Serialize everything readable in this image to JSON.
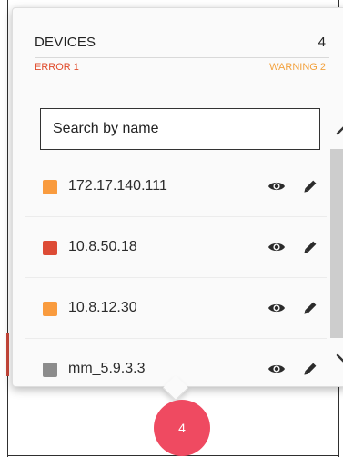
{
  "header": {
    "title": "DEVICES",
    "count": "4",
    "error_label": "ERROR 1",
    "warning_label": "WARNING 2"
  },
  "search": {
    "placeholder": "Search by name",
    "value": ""
  },
  "devices": [
    {
      "name": "172.17.140.111",
      "status": "warning",
      "status_color": "#F99B3E",
      "view_icon": "eye-icon",
      "edit_icon": "pencil-icon"
    },
    {
      "name": "10.8.50.18",
      "status": "error",
      "status_color": "#DD4B35",
      "view_icon": "eye-icon",
      "edit_icon": "pencil-icon"
    },
    {
      "name": "10.8.12.30",
      "status": "warning",
      "status_color": "#F99B3E",
      "view_icon": "eye-icon",
      "edit_icon": "pencil-icon"
    },
    {
      "name": "mm_5.9.3.3",
      "status": "unknown",
      "status_color": "#8C8C8C",
      "view_icon": "eye-icon",
      "edit_icon": "pencil-icon"
    }
  ],
  "scrollbar": {
    "up_icon": "chevron-up-icon",
    "down_icon": "chevron-down-icon"
  },
  "badge": {
    "count": "4",
    "color": "#EF4A61"
  },
  "colors": {
    "error": "#E04A2A",
    "warning": "#F3A23E"
  }
}
